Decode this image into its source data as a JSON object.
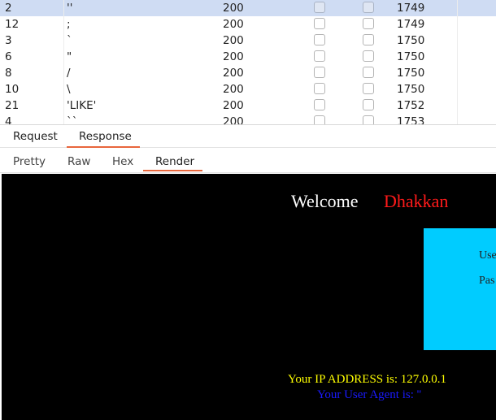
{
  "results": {
    "rows": [
      {
        "request": "2",
        "payload": "''",
        "status": "200",
        "length": "1749",
        "selected": true
      },
      {
        "request": "12",
        "payload": ";",
        "status": "200",
        "length": "1749",
        "selected": false
      },
      {
        "request": "3",
        "payload": "`",
        "status": "200",
        "length": "1750",
        "selected": false
      },
      {
        "request": "6",
        "payload": "\"",
        "status": "200",
        "length": "1750",
        "selected": false
      },
      {
        "request": "8",
        "payload": "/",
        "status": "200",
        "length": "1750",
        "selected": false
      },
      {
        "request": "10",
        "payload": "\\",
        "status": "200",
        "length": "1750",
        "selected": false
      },
      {
        "request": "21",
        "payload": "'LIKE'",
        "status": "200",
        "length": "1752",
        "selected": false
      },
      {
        "request": "4",
        "payload": "``",
        "status": "200",
        "length": "1753",
        "selected": false
      }
    ]
  },
  "tabs": {
    "request": "Request",
    "response": "Response"
  },
  "view_tabs": {
    "pretty": "Pretty",
    "raw": "Raw",
    "hex": "Hex",
    "render": "Render"
  },
  "render": {
    "welcome": "Welcome",
    "name": "Dhakkan",
    "username_label": "Use",
    "password_label": "Pas",
    "ip_line": "Your IP ADDRESS is: 127.0.0.1",
    "ua_line": "Your User Agent is: ''"
  },
  "colors": {
    "accent_underline": "#e8663c",
    "selected_row": "#cfdcf3",
    "render_bg": "#000000",
    "name_red": "#ff1a1a",
    "login_box": "#00ccff",
    "ip_yellow": "#ffff00",
    "ua_blue": "#1a1aff"
  }
}
